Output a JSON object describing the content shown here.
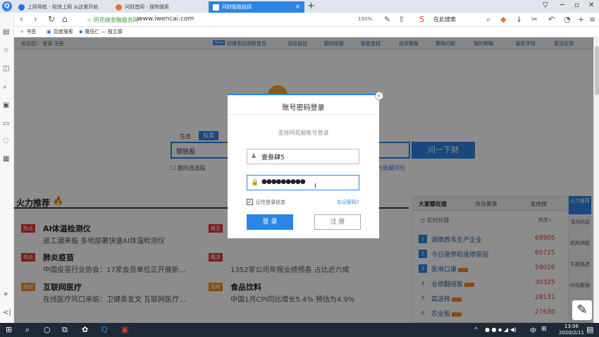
{
  "browser": {
    "tabs": [
      {
        "label": "上网导航 - 轻快上网 从这里开始"
      },
      {
        "label": "问财首网 - 搜狗搜索"
      },
      {
        "label": "问财智能投顾"
      }
    ],
    "tab_close": "×",
    "new_tab": "+",
    "url_site_label": "☆ 同花顺金融服务网",
    "url": "www.iwencai.com",
    "zoom": "150%",
    "search_hint": "在此搜索",
    "bookmarks": [
      {
        "label": "书签"
      },
      {
        "label": "百度搜索"
      },
      {
        "label": "隆伍仁 — 独立那"
      }
    ]
  },
  "site": {
    "topbar_left": "欢迎您！ 登录 注册",
    "new_badge": "New",
    "topnav": [
      "切换到试用新首页",
      "消息监控",
      "题材挖掘",
      "智能查找",
      "投资策略",
      "策略问题",
      "我的策略",
      "股民学校",
      "意见反馈"
    ],
    "search_tab_info": "信息",
    "search_tab_stock": "股票",
    "search_value": "钢铁股",
    "search_button": "问一下财",
    "option_mine": "我的自选股",
    "option_collect": "为收藏问句",
    "hot_title": "火力推荐",
    "hot_items_left": [
      {
        "tag": "热点",
        "title": "AI体温检测仪",
        "desc": "返工潮来临 多地部署快速AI体温检测仪"
      },
      {
        "tag": "热点",
        "title": "肺炎疫苗",
        "desc": "中国疫苗行业协会：17家会员单位正开展新…"
      },
      {
        "tag": "题材",
        "title": "互联网医疗",
        "desc": "在线医疗风口来临：卫健委发文 互联网医疗…"
      }
    ],
    "hot_items_right": [
      {
        "tag": "概念",
        "title": "",
        "desc": ""
      },
      {
        "tag": "概念",
        "title": "",
        "desc": "1352家公司年报业绩预喜 占比近六成"
      },
      {
        "tag": "题材",
        "title": "食品饮料",
        "desc": "中国1月CPI同比增长5.4% 预估为4.9%"
      }
    ],
    "rank_tabs": [
      "大家都在搜",
      "市场聚焦",
      "龙虎榜"
    ],
    "rank_header_left": "实时热搜",
    "rank_header_right": "热度↓",
    "rank_rows": [
      {
        "num": "1",
        "name": "湖德西韦生产企业",
        "value": "68905"
      },
      {
        "num": "2",
        "name": "今日涨停和涨停原因",
        "value": "60725"
      },
      {
        "num": "3",
        "name": "医用口罩",
        "value": "59026"
      },
      {
        "num": "4",
        "name": "业绩翻倍股",
        "value": "30325"
      },
      {
        "num": "5",
        "name": "高送转",
        "value": "28131"
      },
      {
        "num": "6",
        "name": "农业股",
        "value": "27630"
      }
    ],
    "side_head": "火力推荐",
    "side_items": [
      "当月机会",
      "机构持股",
      "牛股挑选",
      "问句集锦",
      "技术"
    ]
  },
  "modal": {
    "title": "账号密码登录",
    "subtitle": "支持同花顺账号登录",
    "username": "壹叁肆5",
    "password": "●●●●●●●●●",
    "remember": "记住登录状态",
    "remember_checked": "✓",
    "forgot": "忘记密码?",
    "login": "登 录",
    "register": "注 册",
    "close": "×"
  },
  "taskbar": {
    "time": "13:06",
    "date": "2020/2/11",
    "ime": "中"
  },
  "colors": {
    "accent": "#2b84e6",
    "hot_red": "#e3382c",
    "tag_orange": "#f08a24"
  }
}
